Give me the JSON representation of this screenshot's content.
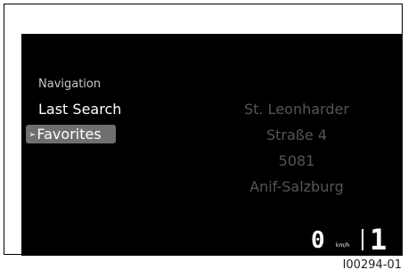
{
  "menu": {
    "header": "Navigation",
    "items": [
      {
        "label": "Last Search"
      },
      {
        "label": "Favorites",
        "selected": true
      }
    ],
    "selected_marker_icon": "arrow-right-icon"
  },
  "address": {
    "line1": "St. Leonharder",
    "line2": "Straße 4",
    "line3": "5081",
    "line4": "Anif-Salzburg"
  },
  "status": {
    "speed": "0",
    "speed_unit": "km/h",
    "gear": "1"
  },
  "figure": {
    "id": "I00294-01"
  }
}
